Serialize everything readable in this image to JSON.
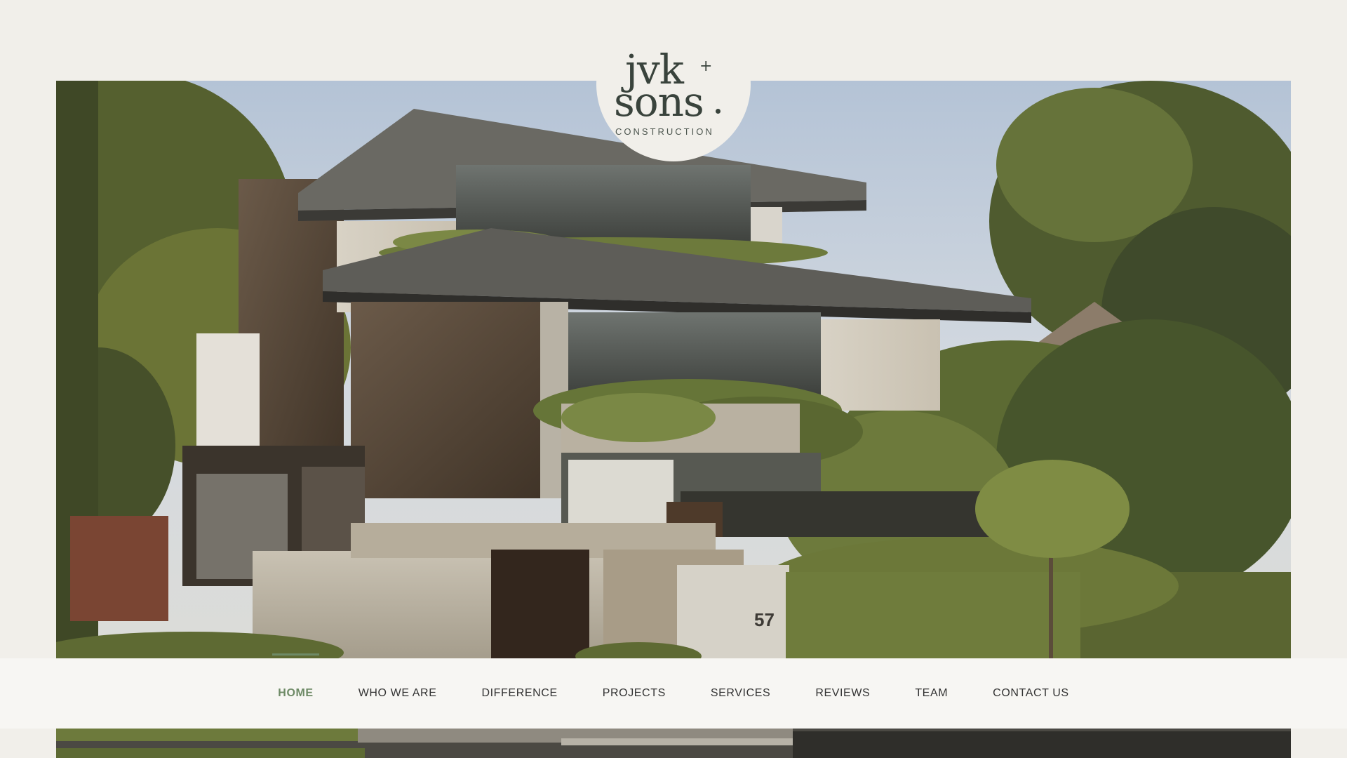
{
  "logo": {
    "line1": "jvk",
    "plus": "+",
    "line2": "sons",
    "sub": "CONSTRUCTION"
  },
  "nav": {
    "items": [
      {
        "label": "HOME",
        "active": true
      },
      {
        "label": "WHO WE ARE",
        "active": false
      },
      {
        "label": "DIFFERENCE",
        "active": false
      },
      {
        "label": "PROJECTS",
        "active": false
      },
      {
        "label": "SERVICES",
        "active": false
      },
      {
        "label": "REVIEWS",
        "active": false
      },
      {
        "label": "TEAM",
        "active": false
      },
      {
        "label": "CONTACT US",
        "active": false
      }
    ]
  },
  "hero": {
    "house_number": "57"
  },
  "colors": {
    "background": "#f1efea",
    "accent": "#6e8a66",
    "logo": "#39433c"
  }
}
